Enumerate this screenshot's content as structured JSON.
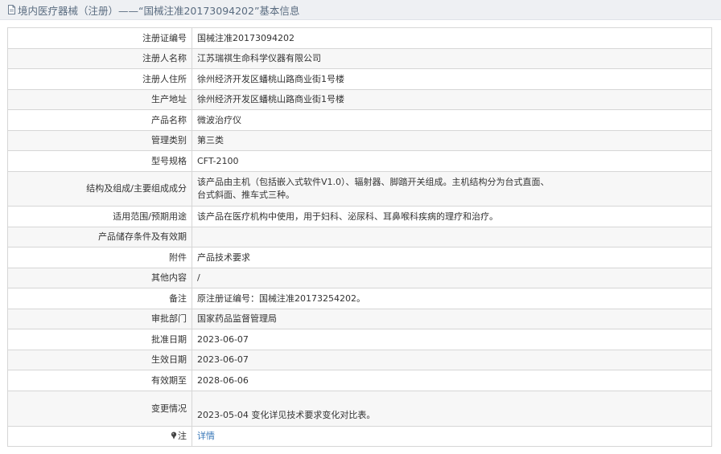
{
  "header": {
    "title": "境内医疗器械（注册）——“国械注准20173094202”基本信息"
  },
  "rows": [
    {
      "label": "注册证编号",
      "value": "国械注准20173094202"
    },
    {
      "label": "注册人名称",
      "value": "江苏瑞祺生命科学仪器有限公司"
    },
    {
      "label": "注册人住所",
      "value": "徐州经济开发区蟠桃山路商业街1号楼"
    },
    {
      "label": "生产地址",
      "value": "徐州经济开发区蟠桃山路商业街1号楼"
    },
    {
      "label": "产品名称",
      "value": "微波治疗仪"
    },
    {
      "label": "管理类别",
      "value": "第三类"
    },
    {
      "label": "型号规格",
      "value": "CFT-2100"
    },
    {
      "label": "结构及组成/主要组成成分",
      "value_line1": "该产品由主机（包括嵌入式软件V1.0）、辐射器、脚踏开关组成。主机结构分为台式直面、",
      "value_line2": "台式斜面、推车式三种。"
    },
    {
      "label": "适用范围/预期用途",
      "value": "该产品在医疗机构中使用，用于妇科、泌尿科、耳鼻喉科疾病的理疗和治疗。"
    },
    {
      "label": "产品储存条件及有效期",
      "value": ""
    },
    {
      "label": "附件",
      "value": "产品技术要求"
    },
    {
      "label": "其他内容",
      "value": "/"
    },
    {
      "label": "备注",
      "value": "原注册证编号：国械注准20173254202。"
    },
    {
      "label": "审批部门",
      "value": "国家药品监督管理局"
    },
    {
      "label": "批准日期",
      "value": "2023-06-07"
    },
    {
      "label": "生效日期",
      "value": "2023-06-07"
    },
    {
      "label": "有效期至",
      "value": "2028-06-06"
    },
    {
      "label": "变更情况",
      "value": "2023-05-04 变化详见技术要求变化对比表。"
    },
    {
      "label": "注",
      "value": "详情"
    }
  ],
  "icons": {
    "header": "document-icon",
    "note": "pin-icon"
  },
  "colors": {
    "header_bg": "#eef0f3",
    "header_text": "#5a6c80",
    "alt_row": "#f7f7f7",
    "border": "#d6d6d6",
    "link": "#3a78b8"
  }
}
